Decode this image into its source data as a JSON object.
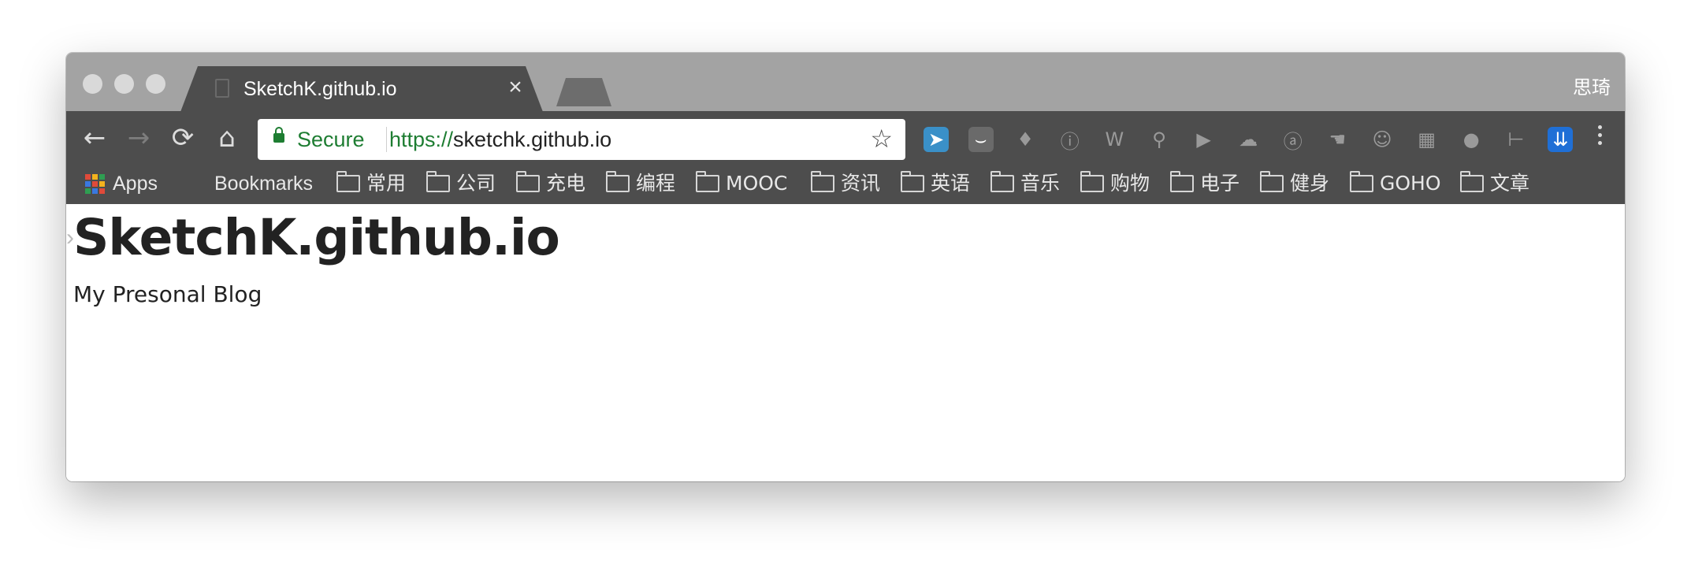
{
  "tab": {
    "title": "SketchK.github.io",
    "close": "×"
  },
  "profile": {
    "name": "思琦"
  },
  "toolbar": {
    "back": "←",
    "forward": "→",
    "reload": "⟳",
    "home": "⌂",
    "secure_label": "Secure",
    "url_scheme": "https://",
    "url_rest": "sketchk.github.io",
    "star": "☆"
  },
  "extensions": [
    {
      "name": "telegram-extension-icon",
      "color": "#3a90c8",
      "glyph": "➤"
    },
    {
      "name": "pocket-extension-icon",
      "color": "#6a6a6a",
      "glyph": "⌣"
    },
    {
      "name": "gem-extension-icon",
      "color": "#4d4d4d",
      "glyph": "♦"
    },
    {
      "name": "info-extension-icon",
      "color": "#4d4d4d",
      "glyph": "ⓘ"
    },
    {
      "name": "w-extension-icon",
      "color": "#4d4d4d",
      "glyph": "W"
    },
    {
      "name": "search-extension-icon",
      "color": "#4d4d4d",
      "glyph": "⚲"
    },
    {
      "name": "play-extension-icon",
      "color": "#4d4d4d",
      "glyph": "▶"
    },
    {
      "name": "cloud-extension-icon",
      "color": "#4d4d4d",
      "glyph": "☁"
    },
    {
      "name": "at-extension-icon",
      "color": "#4d4d4d",
      "glyph": "ⓐ"
    },
    {
      "name": "hand-extension-icon",
      "color": "#4d4d4d",
      "glyph": "☚"
    },
    {
      "name": "robot-extension-icon",
      "color": "#4d4d4d",
      "glyph": "☺"
    },
    {
      "name": "grid-extension-icon",
      "color": "#4d4d4d",
      "glyph": "▦"
    },
    {
      "name": "circle-extension-icon",
      "color": "#4d4d4d",
      "glyph": "●"
    },
    {
      "name": "ruler-extension-icon",
      "color": "#4d4d4d",
      "glyph": "⊢"
    },
    {
      "name": "download-extension-icon",
      "color": "#1f6fd6",
      "glyph": "⇊"
    }
  ],
  "bookmarks": {
    "apps": "Apps",
    "bookmarks": "Bookmarks",
    "folders": [
      "常用",
      "公司",
      "充电",
      "编程",
      "MOOC",
      "资讯",
      "英语",
      "音乐",
      "购物",
      "电子",
      "健身",
      "GOHO",
      "文章"
    ]
  },
  "page": {
    "title": "SketchK.github.io",
    "subtitle": "My Presonal Blog"
  }
}
